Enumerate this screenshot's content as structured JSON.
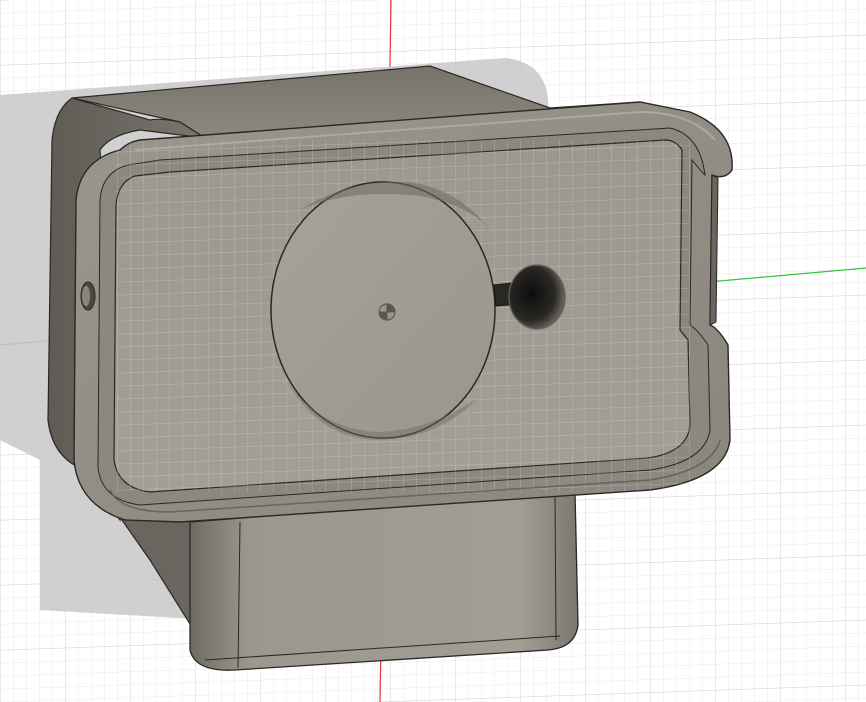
{
  "viewport": {
    "view": "cad-3d-model-viewport",
    "background_color": "#ffffff",
    "grid_minor_color": "#e6e6e6",
    "grid_major_color": "#cfcfcf",
    "x_axis_color": "#e2363c",
    "y_axis_color": "#35c43c",
    "model_body_color": "#8e8a81",
    "model_edge_color": "#2a2824",
    "shadow_color": "#c6c6c6"
  },
  "model": {
    "features": [
      "rectangular-pocket",
      "circular-recess",
      "small-hole",
      "side-notch",
      "side-pin-hole",
      "lower-block",
      "origin-marker"
    ]
  }
}
